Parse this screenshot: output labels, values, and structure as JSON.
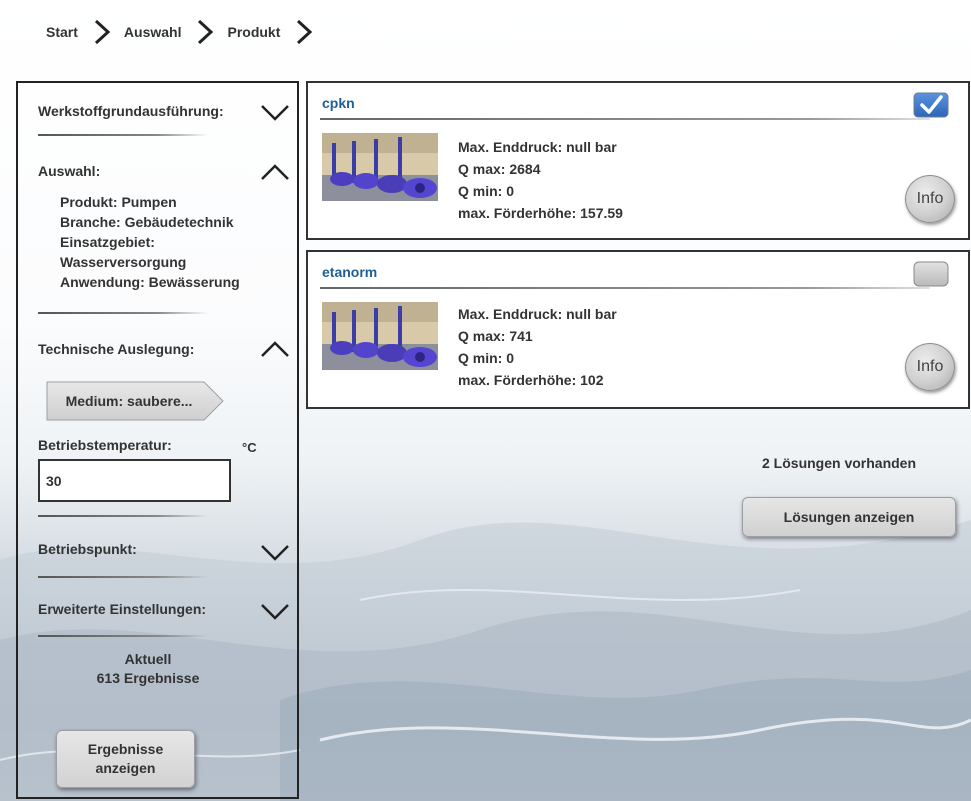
{
  "breadcrumb": {
    "items": [
      "Start",
      "Auswahl",
      "Produkt"
    ]
  },
  "sidebar": {
    "material_title": "Werkstoffgrundausführung:",
    "selection_title": "Auswahl:",
    "selection_lines": [
      "Produkt: Pumpen",
      "Branche: Gebäudetechnik",
      "Einsatzgebiet:",
      "Wasserversorgung",
      "Anwendung: Bewässerung"
    ],
    "technical_title": "Technische Auslegung:",
    "medium_label": "Medium: saubere...",
    "temperature_label": "Betriebstemperatur:",
    "temperature_value": "30",
    "temperature_unit": "°C",
    "operating_point_title": "Betriebspunkt:",
    "advanced_title": "Erweiterte Einstellungen:",
    "current_label": "Aktuell",
    "results_count": "613 Ergebnisse",
    "results_button_line1": "Ergebnisse",
    "results_button_line2": "anzeigen"
  },
  "products": [
    {
      "name": "cpkn",
      "checked": true,
      "specs": [
        "Max. Enddruck: null bar",
        "Q max: 2684",
        "Q min: 0",
        "max. Förderhöhe: 157.59"
      ],
      "info_label": "Info"
    },
    {
      "name": "etanorm",
      "checked": false,
      "specs": [
        "Max. Enddruck: null bar",
        "Q max: 741",
        "Q min: 0",
        "max. Förderhöhe: 102"
      ],
      "info_label": "Info"
    }
  ],
  "solutions": {
    "count_text": "2 Lösungen vorhanden",
    "button_label": "Lösungen anzeigen"
  },
  "colors": {
    "product_title": "#1f5f95",
    "checkbox_checked": "#3a73c9",
    "border": "#222222"
  }
}
